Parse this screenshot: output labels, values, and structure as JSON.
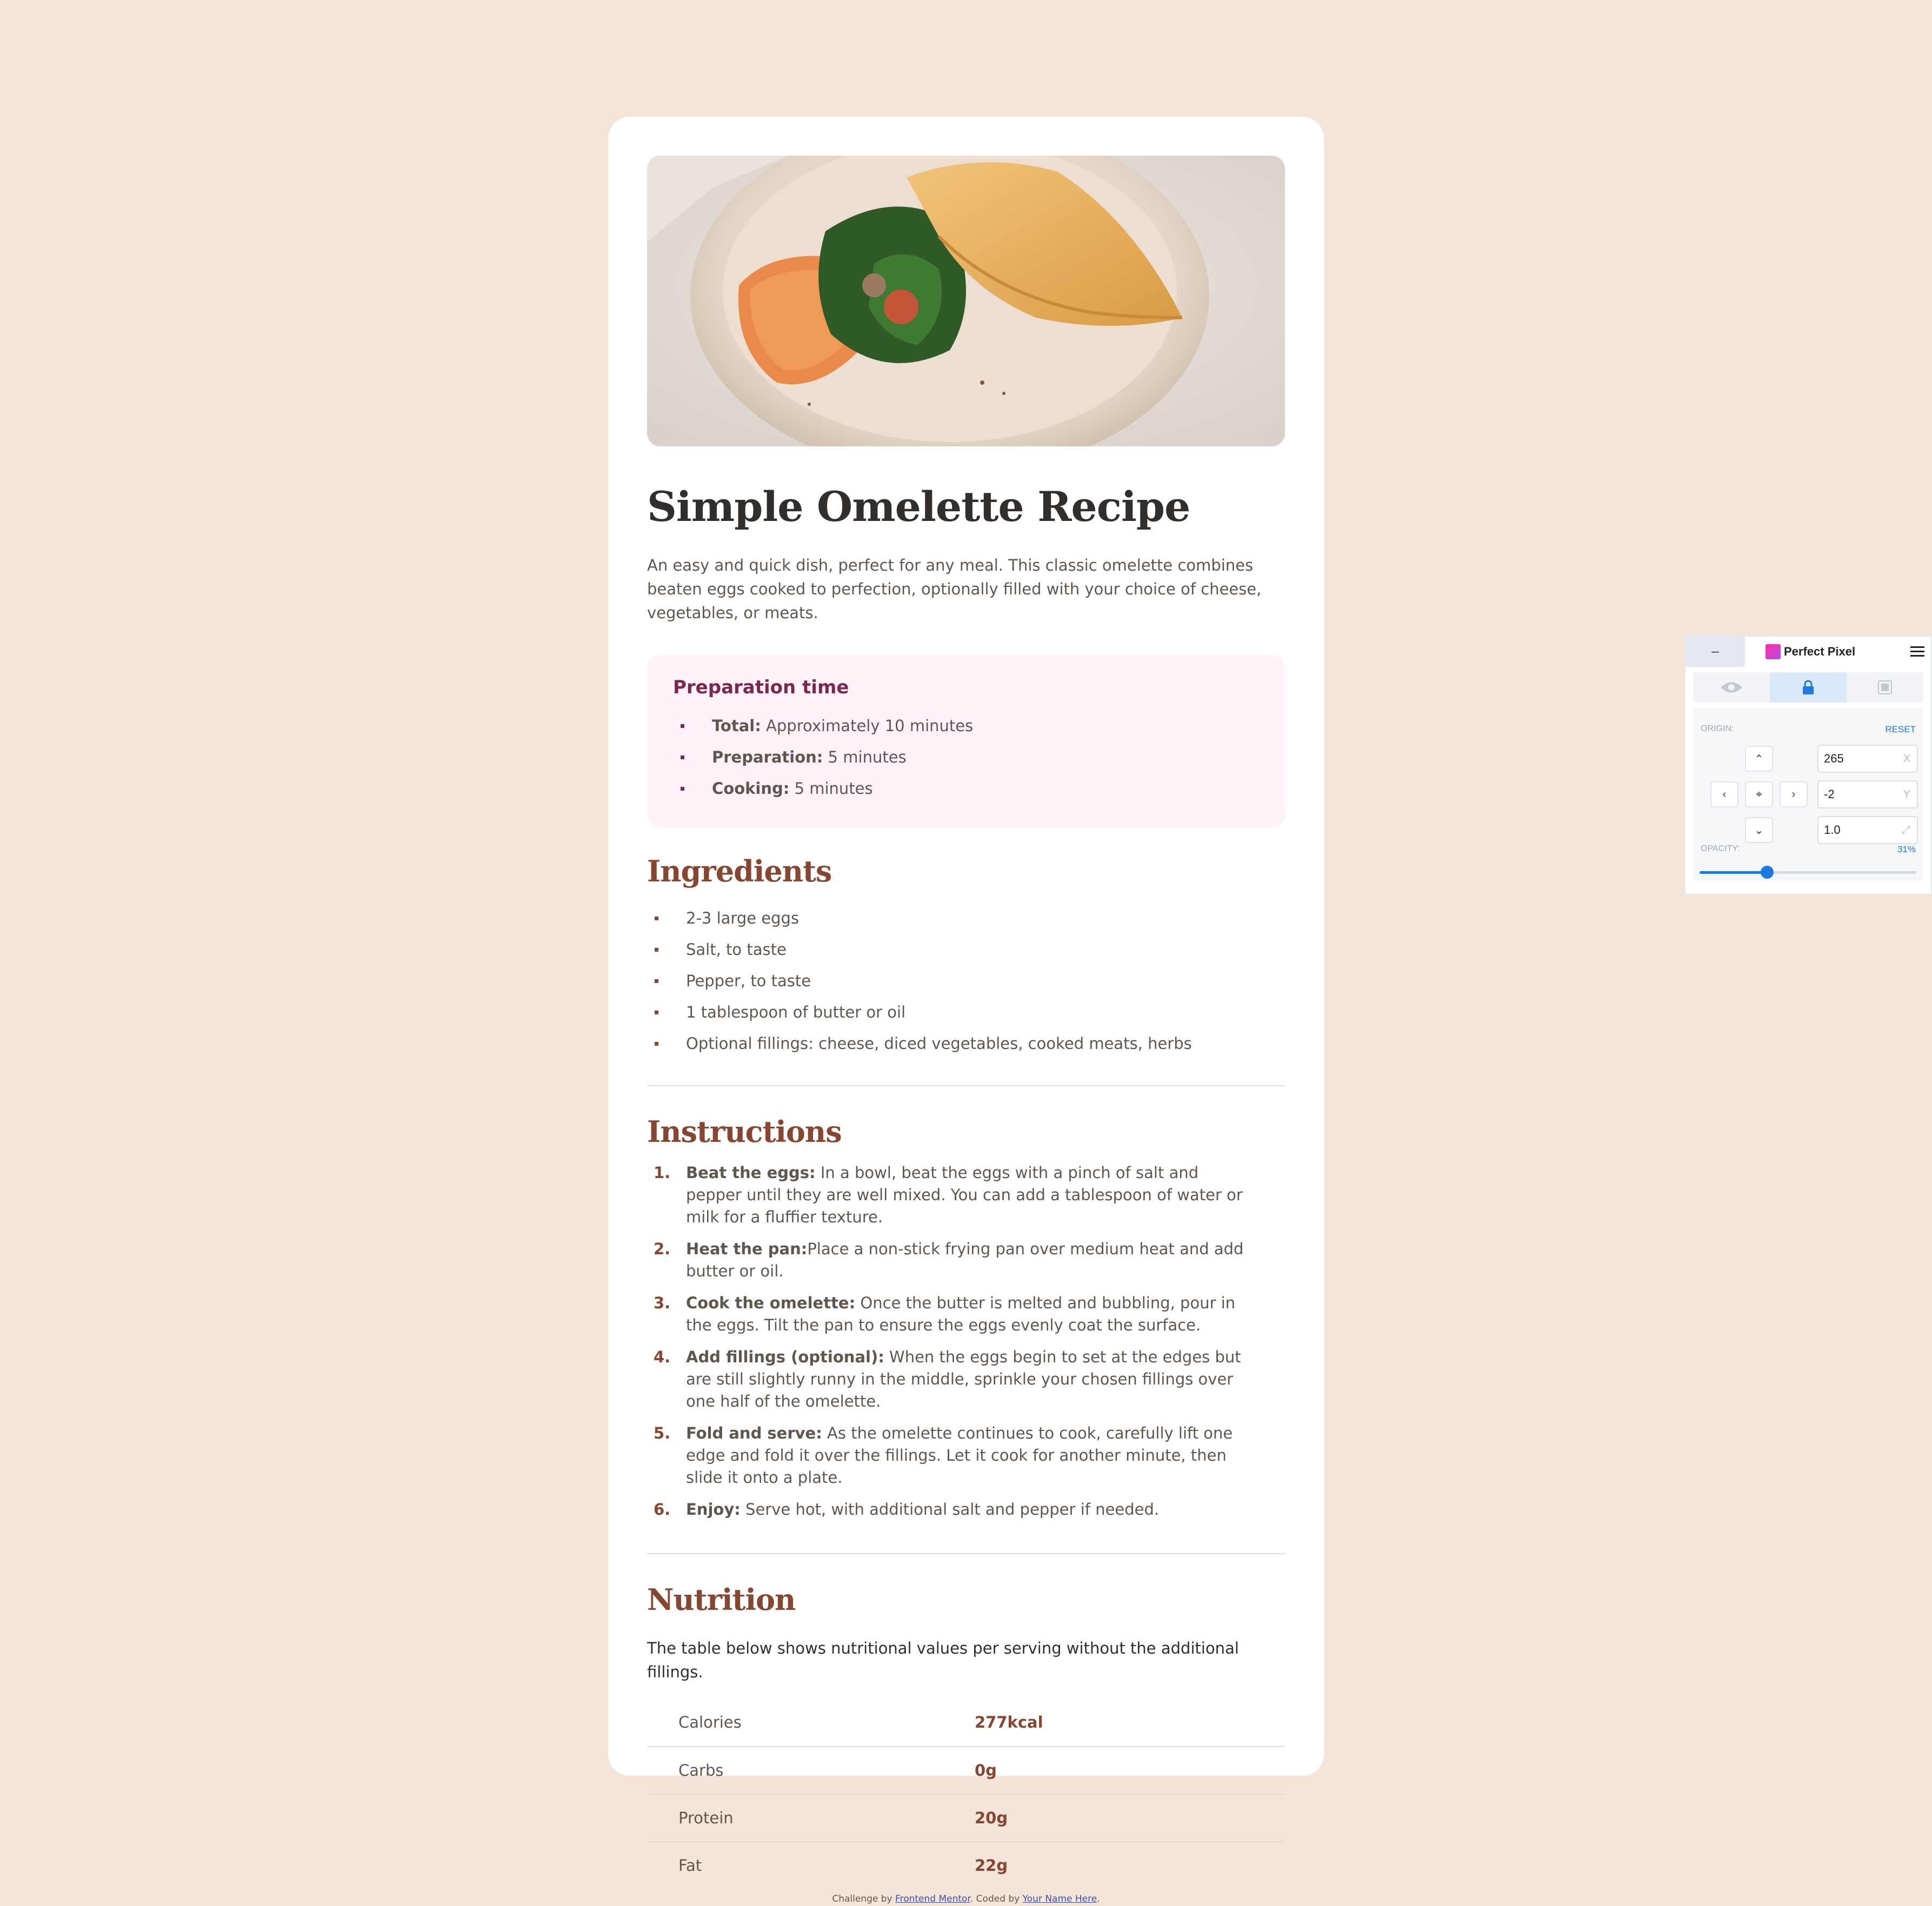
{
  "recipe": {
    "title": "Simple Omelette Recipe",
    "intro": "An easy and quick dish, perfect for any meal. This classic omelette combines beaten eggs cooked to perfection, optionally filled with your choice of cheese, vegetables, or meats.",
    "prep": {
      "heading": "Preparation time",
      "items": [
        {
          "label": "Total:",
          "text": " Approximately 10 minutes"
        },
        {
          "label": "Preparation:",
          "text": " 5 minutes"
        },
        {
          "label": "Cooking:",
          "text": " 5 minutes"
        }
      ]
    },
    "ingredients": {
      "heading": "Ingredients",
      "items": [
        "2-3 large eggs",
        "Salt, to taste",
        "Pepper, to taste",
        "1 tablespoon of butter or oil",
        "Optional fillings: cheese, diced vegetables, cooked meats, herbs"
      ]
    },
    "instructions": {
      "heading": "Instructions",
      "items": [
        {
          "num": "1.",
          "label": "Beat the eggs:",
          "text": " In a bowl, beat the eggs with a pinch of salt and pepper until they are well mixed. You can add a tablespoon of water or milk for a fluffier texture."
        },
        {
          "num": "2.",
          "label": "Heat the pan:",
          "text": "Place a non-stick frying pan over medium heat and add butter or oil."
        },
        {
          "num": "3.",
          "label": "Cook the omelette:",
          "text": " Once the butter is melted and bubbling, pour in the eggs. Tilt the pan to ensure the eggs evenly coat the surface."
        },
        {
          "num": "4.",
          "label": "Add fillings (optional):",
          "text": " When the eggs begin to set at the edges but are still slightly runny in the middle, sprinkle your chosen fillings over one half of the omelette."
        },
        {
          "num": "5.",
          "label": "Fold and serve:",
          "text": " As the omelette continues to cook, carefully lift one edge and fold it over the fillings. Let it cook for another minute, then slide it onto a plate."
        },
        {
          "num": "6.",
          "label": "Enjoy:",
          "text": " Serve hot, with additional salt and pepper if needed."
        }
      ]
    },
    "nutrition": {
      "heading": "Nutrition",
      "note": "The table below shows nutritional values per serving without the additional fillings.",
      "rows": [
        {
          "label": "Calories",
          "value": "277kcal"
        },
        {
          "label": "Carbs",
          "value": "0g"
        },
        {
          "label": "Protein",
          "value": "20g"
        },
        {
          "label": "Fat",
          "value": "22g"
        }
      ]
    }
  },
  "attribution": {
    "prefix": "Challenge by ",
    "link1": "Frontend Mentor",
    "middle": ". Coded by ",
    "link2": "Your Name Here",
    "suffix": "."
  },
  "perfect_pixel": {
    "minimize": "–",
    "title": "Perfect Pixel",
    "origin_label": "ORIGIN:",
    "reset_label": "RESET",
    "x_value": "265",
    "x_suffix": "X",
    "y_value": "-2",
    "y_suffix": "Y",
    "scale_value": "1.0",
    "scale_suffix": "⤢",
    "opacity_label": "OPACITY:",
    "opacity_text": "31%",
    "opacity": 0.31
  },
  "colors": {
    "background": "#f4e5d8",
    "accent_brown": "#854632",
    "accent_rose": "#7a284e",
    "prep_bg": "#fff3f9",
    "pp_blue": "#1f7ae0"
  }
}
